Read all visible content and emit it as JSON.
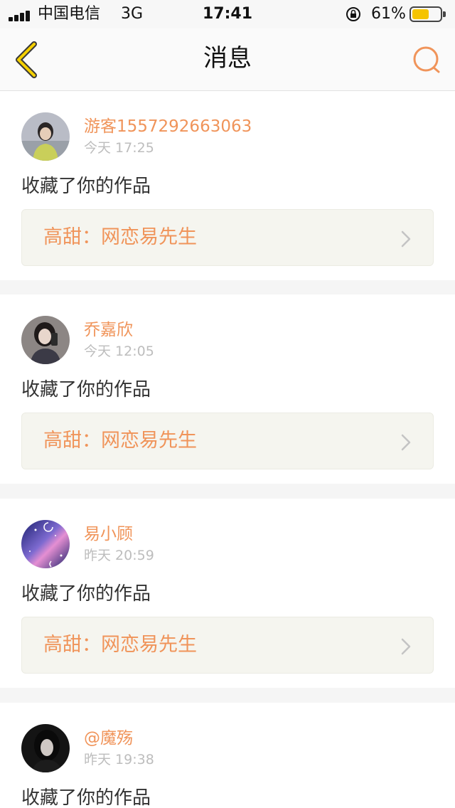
{
  "status_bar": {
    "carrier": "中国电信",
    "network": "3G",
    "time": "17:41",
    "battery_percent": "61%",
    "battery_level": 0.61,
    "battery_color": "#f5c400"
  },
  "nav": {
    "title": "消息",
    "back_icon": "chevron-left-icon",
    "search_icon": "search-icon",
    "accent_color": "#f0945a"
  },
  "messages": [
    {
      "username": "游客1557292663063",
      "time": "今天 17:25",
      "action": "收藏了你的作品",
      "work_title": "高甜：网恋易先生"
    },
    {
      "username": "乔嘉欣",
      "time": "今天 12:05",
      "action": "收藏了你的作品",
      "work_title": "高甜：网恋易先生"
    },
    {
      "username": "易小顾",
      "time": "昨天 20:59",
      "action": "收藏了你的作品",
      "work_title": "高甜：网恋易先生"
    },
    {
      "username": "@魔殇",
      "time": "昨天 19:38",
      "action": "收藏了你的作品"
    }
  ]
}
